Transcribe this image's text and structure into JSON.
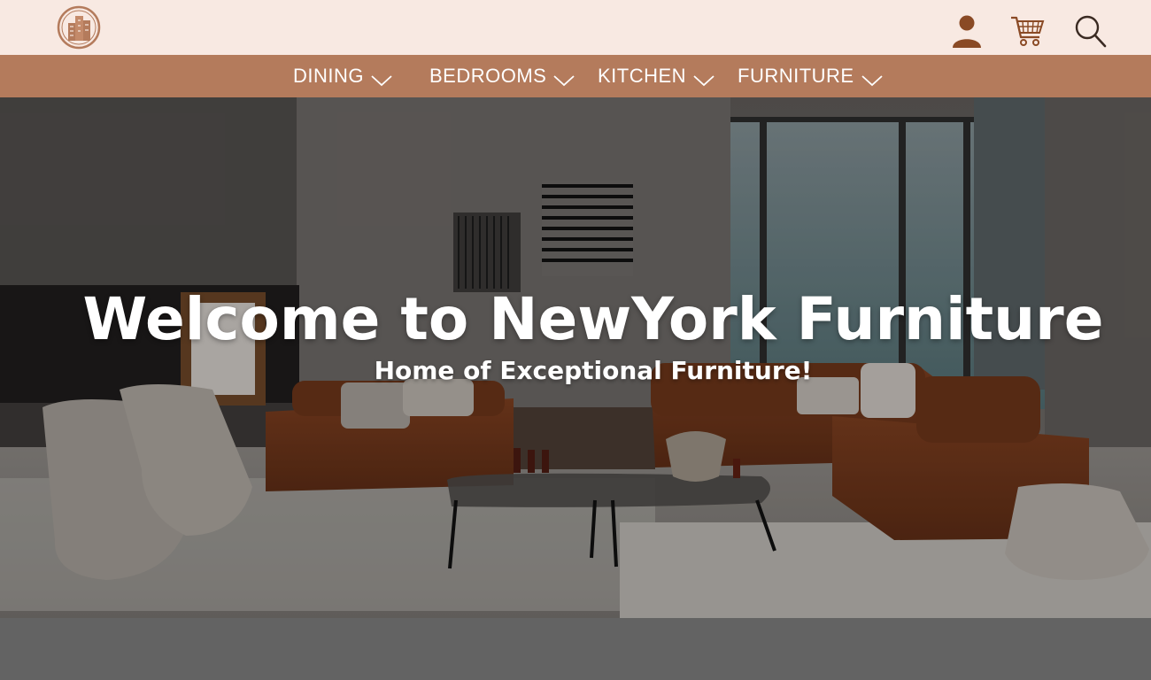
{
  "header": {
    "logo_icon": "building-logo-icon",
    "icons": [
      "user-icon",
      "cart-icon",
      "search-icon"
    ]
  },
  "nav": {
    "items": [
      {
        "label": "DINING",
        "icon": "chevron-down-icon"
      },
      {
        "label": "BEDROOMS",
        "icon": "chevron-down-icon"
      },
      {
        "label": "KITCHEN",
        "icon": "chevron-down-icon"
      },
      {
        "label": "FURNITURE",
        "icon": "chevron-down-icon"
      }
    ]
  },
  "hero": {
    "title": "Welcome to NewYork Furniture",
    "subtitle": "Home of Exceptional Furniture!"
  },
  "colors": {
    "header_bg": "#f8e9e2",
    "nav_bg": "#b47b5c",
    "accent_brown": "#8a4a25",
    "page_bg": "#636363"
  }
}
